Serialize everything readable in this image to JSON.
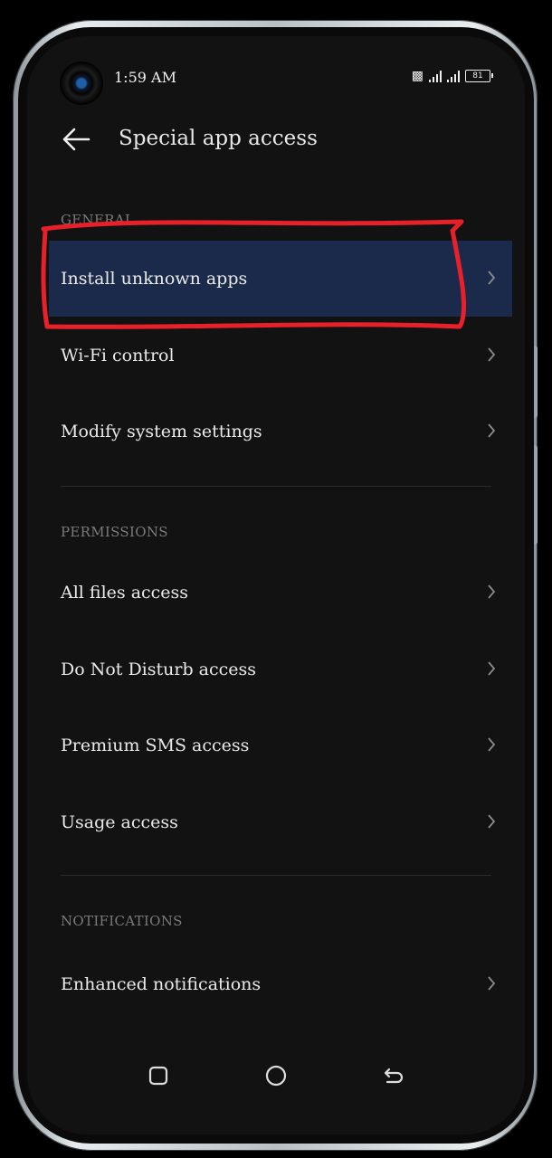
{
  "status": {
    "time": "1:59 AM",
    "battery": "81"
  },
  "appbar": {
    "title": "Special app access"
  },
  "sections": {
    "general": "GENERAL",
    "permissions": "PERMISSIONS",
    "notifications": "NOTIFICATIONS"
  },
  "items": {
    "install_unknown_apps": "Install unknown apps",
    "wifi_control": "Wi-Fi control",
    "modify_system_settings": "Modify system settings",
    "all_files_access": "All files access",
    "dnd_access": "Do Not Disturb access",
    "premium_sms_access": "Premium SMS access",
    "usage_access": "Usage access",
    "enhanced_notifications": "Enhanced notifications"
  },
  "colors": {
    "background": "#121212",
    "active_row": "#1b2a4a",
    "highlight_stroke": "#e8202a"
  },
  "icons": [
    "back-arrow-icon",
    "chevron-right-icon",
    "camera-icon",
    "signal-icon",
    "battery-icon",
    "recents-icon",
    "home-icon",
    "back-gesture-icon"
  ]
}
